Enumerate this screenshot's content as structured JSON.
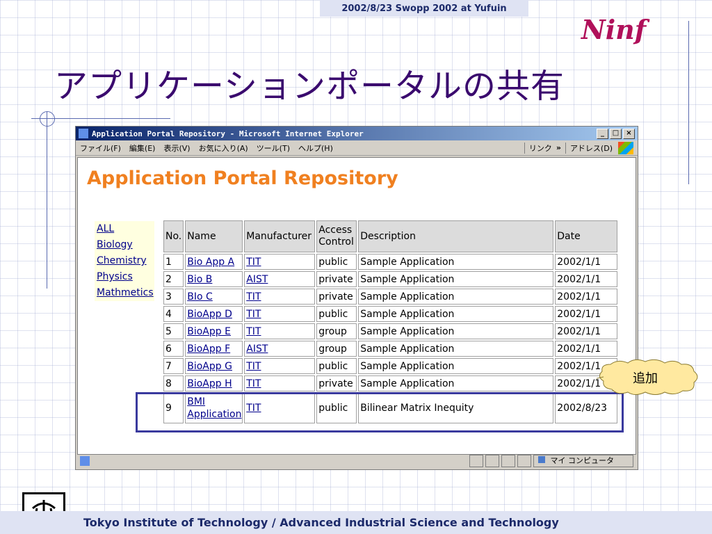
{
  "slide": {
    "header_banner": "2002/8/23 Swopp 2002 at Yufuin",
    "logo_text": "Ninf",
    "title": "アプリケーションポータルの共有",
    "footer": "Tokyo Institute of Technology / Advanced Industrial Science and Technology",
    "callout": "追加"
  },
  "browser": {
    "title": "Application Portal Repository - Microsoft Internet Explorer",
    "window_buttons": [
      "_",
      "□",
      "×"
    ],
    "menu": [
      "ファイル(F)",
      "編集(E)",
      "表示(V)",
      "お気に入り(A)",
      "ツール(T)",
      "ヘルプ(H)"
    ],
    "links_label": "リンク",
    "links_chevron": "»",
    "address_label": "アドレス(D)",
    "status_zone": "マイ コンピュータ"
  },
  "page": {
    "heading": "Application Portal Repository",
    "categories": [
      "ALL",
      "Biology",
      "Chemistry",
      "Physics",
      "Mathmetics"
    ],
    "table": {
      "headers": [
        "No.",
        "Name",
        "Manufacturer",
        "Access Control",
        "Description",
        "Date"
      ],
      "rows": [
        {
          "no": "1",
          "name": "Bio App A",
          "manufacturer": "TIT",
          "access": "public",
          "description": "Sample Application",
          "date": "2002/1/1"
        },
        {
          "no": "2",
          "name": "Bio B",
          "manufacturer": "AIST",
          "access": "private",
          "description": "Sample Application",
          "date": "2002/1/1"
        },
        {
          "no": "3",
          "name": "BIo C",
          "manufacturer": "TIT",
          "access": "private",
          "description": "Sample Application",
          "date": "2002/1/1"
        },
        {
          "no": "4",
          "name": "BioApp D",
          "manufacturer": "TIT",
          "access": "public",
          "description": "Sample Application",
          "date": "2002/1/1"
        },
        {
          "no": "5",
          "name": "BioApp E",
          "manufacturer": "TIT",
          "access": "group",
          "description": "Sample Application",
          "date": "2002/1/1"
        },
        {
          "no": "6",
          "name": "BioApp F",
          "manufacturer": "AIST",
          "access": "group",
          "description": "Sample Application",
          "date": "2002/1/1"
        },
        {
          "no": "7",
          "name": "BioApp G",
          "manufacturer": "TIT",
          "access": "public",
          "description": "Sample Application",
          "date": "2002/1/1"
        },
        {
          "no": "8",
          "name": "BioApp H",
          "manufacturer": "TIT",
          "access": "private",
          "description": "Sample Application",
          "date": "2002/1/1"
        },
        {
          "no": "9",
          "name": "BMI Application",
          "manufacturer": "TIT",
          "access": "public",
          "description": "Bilinear Matrix Inequity",
          "date": "2002/8/23"
        }
      ]
    }
  },
  "colors": {
    "title": "#3a0a6e",
    "heading": "#f08020",
    "link": "#00008b",
    "highlight_border": "#3a3a9e",
    "callout_fill": "#ffe9a0"
  }
}
